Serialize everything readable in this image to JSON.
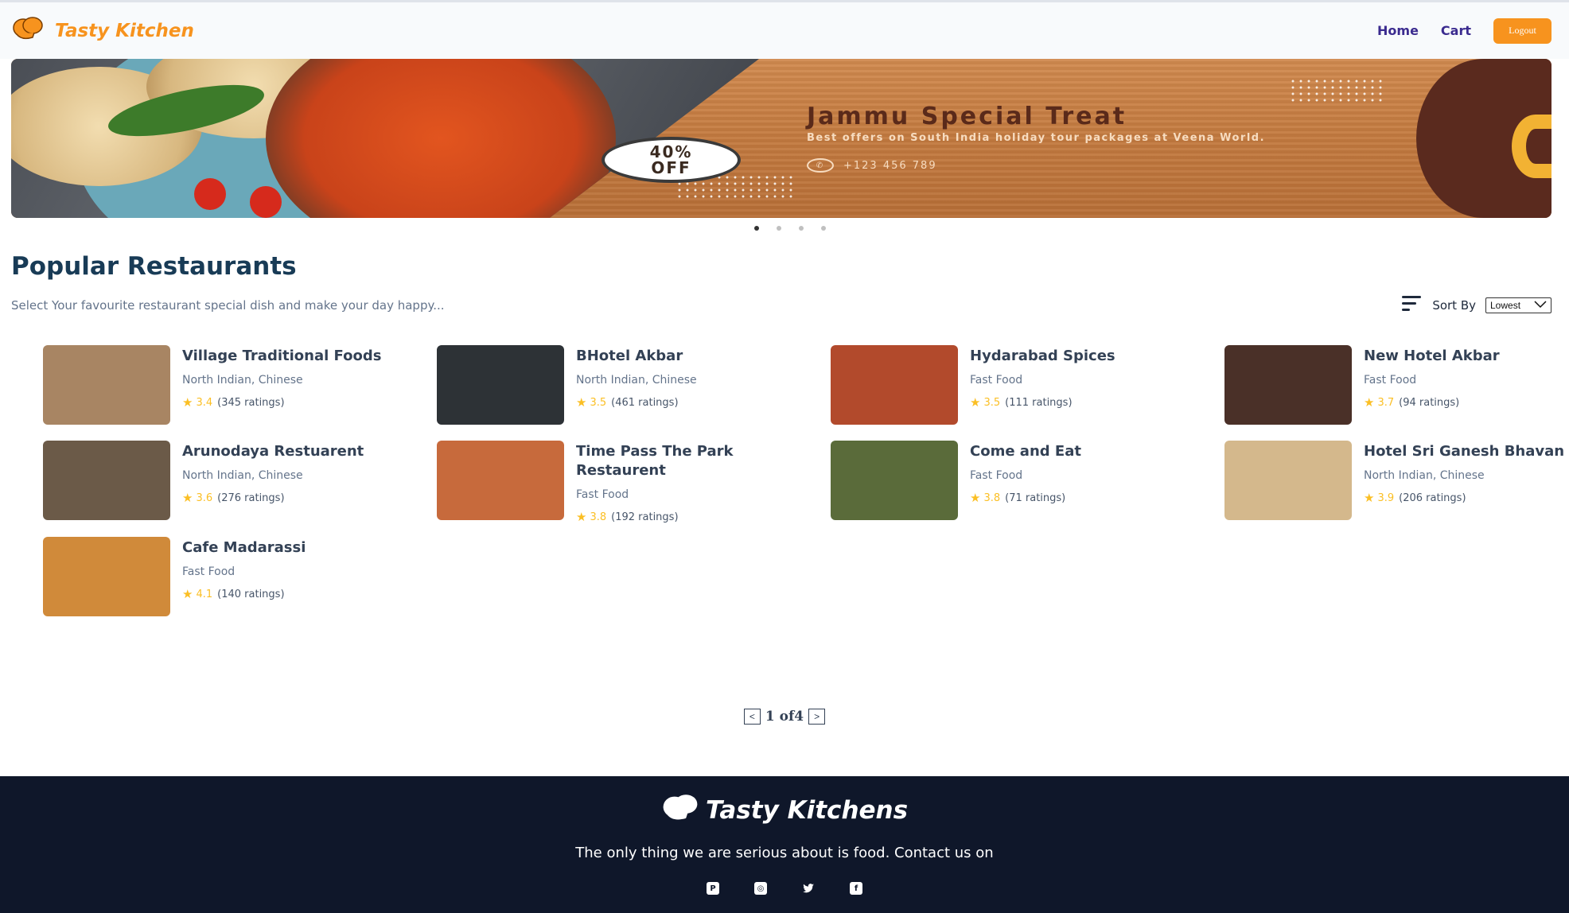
{
  "navbar": {
    "brand": "Tasty Kitchen",
    "links": [
      "Home",
      "Cart"
    ],
    "logout_label": "Logout"
  },
  "banner": {
    "title": "Jammu Special Treat",
    "subtitle": "Best offers on South India holiday tour packages at Veena World.",
    "phone": "+123 456 789",
    "offer_line1": "40%",
    "offer_line2": "OFF",
    "slide_count": 4,
    "active_slide": 1
  },
  "main": {
    "title": "Popular Restaurants",
    "subtitle": "Select Your favourite restaurant special dish and make your day happy...",
    "sort_label": "Sort By",
    "sort_selected": "Lowest"
  },
  "restaurants": [
    {
      "name": "Village Traditional Foods",
      "cuisine": "North Indian, Chinese",
      "rating": "3.4",
      "ratings_count": "(345 ratings)",
      "thumb_color": "#a88563"
    },
    {
      "name": "BHotel Akbar",
      "cuisine": "North Indian, Chinese",
      "rating": "3.5",
      "ratings_count": "(461 ratings)",
      "thumb_color": "#2d3236"
    },
    {
      "name": "Hydarabad Spices",
      "cuisine": "Fast Food",
      "rating": "3.5",
      "ratings_count": "(111 ratings)",
      "thumb_color": "#b24a2c"
    },
    {
      "name": "New Hotel Akbar",
      "cuisine": "Fast Food",
      "rating": "3.7",
      "ratings_count": "(94 ratings)",
      "thumb_color": "#4a3028"
    },
    {
      "name": "Arunodaya Restuarent",
      "cuisine": "North Indian, Chinese",
      "rating": "3.6",
      "ratings_count": "(276 ratings)",
      "thumb_color": "#6b5a48"
    },
    {
      "name": "Time Pass The Park Restaurent",
      "cuisine": "Fast Food",
      "rating": "3.8",
      "ratings_count": "(192 ratings)",
      "thumb_color": "#c76a3c"
    },
    {
      "name": "Come and Eat",
      "cuisine": "Fast Food",
      "rating": "3.8",
      "ratings_count": "(71 ratings)",
      "thumb_color": "#5a6b3a"
    },
    {
      "name": "Hotel Sri Ganesh Bhavan",
      "cuisine": "North Indian, Chinese",
      "rating": "3.9",
      "ratings_count": "(206 ratings)",
      "thumb_color": "#d4b88c"
    },
    {
      "name": "Cafe Madarassi",
      "cuisine": "Fast Food",
      "rating": "4.1",
      "ratings_count": "(140 ratings)",
      "thumb_color": "#d08a3a"
    }
  ],
  "pagination": {
    "prev": "<",
    "text": "1 of4",
    "next": ">"
  },
  "footer": {
    "brand": "Tasty Kitchens",
    "tagline": "The only thing we are serious about is food. Contact us on",
    "socials": [
      "pinterest-icon",
      "instagram-icon",
      "twitter-icon",
      "facebook-icon"
    ]
  },
  "colors": {
    "accent": "#f7931e",
    "nav_link": "#3b2b8f",
    "heading": "#183b56",
    "footer_bg": "#0f172a",
    "star": "#fbbf24"
  }
}
